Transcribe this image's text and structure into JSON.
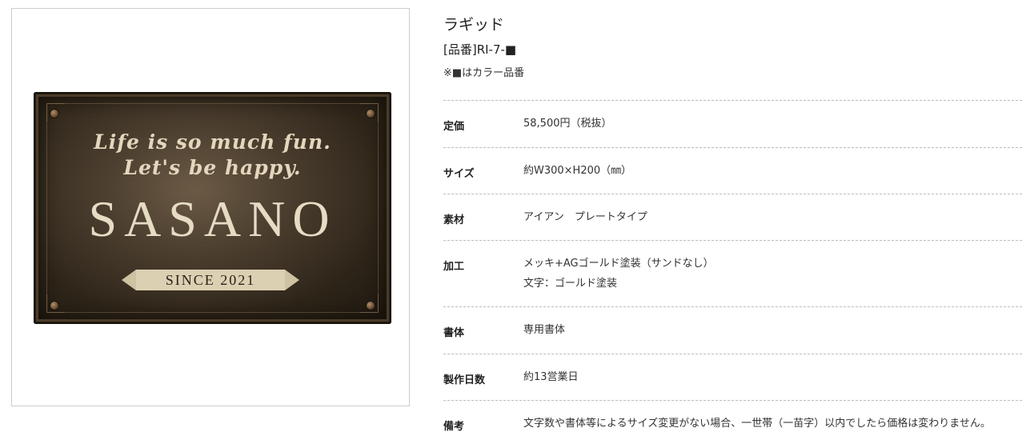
{
  "product": {
    "name": "ラギッド",
    "code": "[品番]RI-7-■",
    "note": "※■はカラー品番"
  },
  "plate_image": {
    "script_line_1": "Life is so much fun.",
    "script_line_2": "Let's be happy.",
    "name": "SASANO",
    "banner": "SINCE 2021",
    "colors": {
      "plate": "#3a2f22",
      "lettering": "#e3d6bd",
      "banner": "#dcd0b3"
    }
  },
  "specs": [
    {
      "label": "定価",
      "values": [
        "58,500円（税抜）"
      ]
    },
    {
      "label": "サイズ",
      "values": [
        "約W300×H200（㎜）"
      ]
    },
    {
      "label": "素材",
      "values": [
        "アイアン　プレートタイプ"
      ]
    },
    {
      "label": "加工",
      "values": [
        "メッキ+AGゴールド塗装（サンドなし）",
        "文字：ゴールド塗装"
      ]
    },
    {
      "label": "書体",
      "values": [
        "専用書体"
      ]
    },
    {
      "label": "製作日数",
      "values": [
        "約13営業日"
      ]
    },
    {
      "label": "備考",
      "values": [
        "文字数や書体等によるサイズ変更がない場合、一世帯（一苗字）以内でしたら価格は変わりません。"
      ]
    }
  ]
}
